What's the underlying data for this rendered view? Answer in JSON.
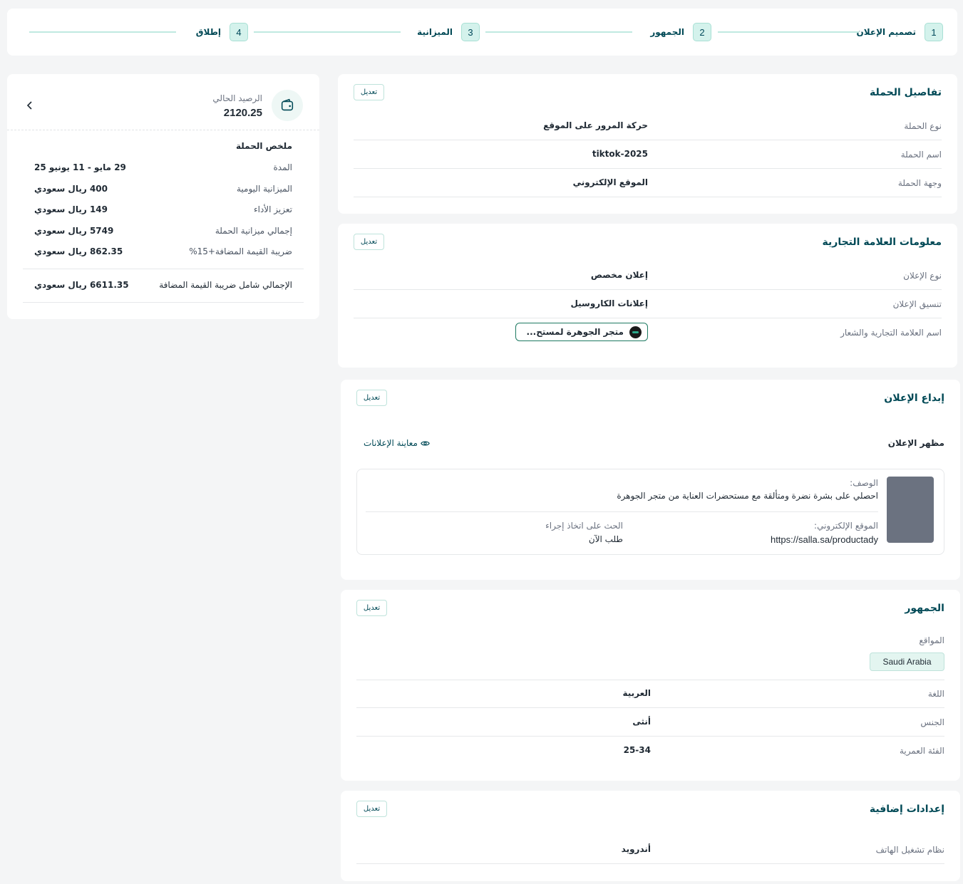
{
  "stepper": {
    "steps": [
      {
        "num": "1",
        "label": "تصميم الإعلان"
      },
      {
        "num": "2",
        "label": "الجمهور"
      },
      {
        "num": "3",
        "label": "الميزانية"
      },
      {
        "num": "4",
        "label": "إطلاق"
      }
    ]
  },
  "common": {
    "edit_label": "تعديل"
  },
  "campaign_details": {
    "title": "تفاصيل الحملة",
    "rows": [
      {
        "label": "نوع الحملة",
        "value": "حركة المرور على الموقع"
      },
      {
        "label": "اسم الحملة",
        "value": "tiktok-2025"
      },
      {
        "label": "وجهة الحملة",
        "value": "الموقع الإلكتروني"
      }
    ]
  },
  "brand_info": {
    "title": "معلومات العلامة التجارية",
    "rows": [
      {
        "label": "نوع الإعلان",
        "value": "إعلان مخصص"
      },
      {
        "label": "تنسيق الإعلان",
        "value": "إعلانات الكاروسيل"
      }
    ],
    "brand_label": "اسم العلامة التجارية والشعار",
    "brand_name": "متجر الجوهرة لمستح..."
  },
  "creative": {
    "title": "إبداع الإعلان",
    "appearance_label": "مظهر الإعلان",
    "preview_link": "معاينة الإعلانات",
    "description_label": "الوصف:",
    "description": "احصلي على بشرة نضرة ومتألقة مع مستحضرات العناية من متجر الجوهرة",
    "website_label": "الموقع الإلكتروني:",
    "website": "https://salla.sa/productady",
    "cta_label": "الحث على اتخاذ إجراء",
    "cta": "طلب الآن"
  },
  "audience": {
    "title": "الجمهور",
    "locations_label": "المواقع",
    "location_chip": "Saudi Arabia",
    "rows": [
      {
        "label": "اللغة",
        "value": "العربية"
      },
      {
        "label": "الجنس",
        "value": "أنثى"
      },
      {
        "label": "الفئة العمرية",
        "value": "25-34"
      }
    ]
  },
  "extra": {
    "title": "إعدادات إضافية",
    "rows": [
      {
        "label": "نظام تشغيل الهاتف",
        "value": "أندرويد"
      }
    ]
  },
  "summary": {
    "balance_label": "الرصيد الحالي",
    "balance": "2120.25",
    "title": "ملخص الحملة",
    "rows": [
      {
        "label": "المدة",
        "value": "29 مايو - 11 يونيو 25"
      },
      {
        "label": "الميزانية اليومية",
        "value": "400 ريال سعودي"
      },
      {
        "label": "تعزيز الأداء",
        "value": "149 ريال سعودي"
      },
      {
        "label": "إجمالي ميزانية الحملة",
        "value": "5749 ريال سعودي"
      },
      {
        "label": "ضريبة القيمة المضافة+15%",
        "value": "862.35 ريال سعودي"
      }
    ],
    "total_label": "الإجمالي شامل ضريبة القيمة المضافة",
    "total_value": "6611.35 ريال سعودي"
  },
  "icons": {
    "wallet": "wallet-icon",
    "chevron": "chevron-left-icon",
    "eye": "eye-icon"
  },
  "colors": {
    "accent": "#004956",
    "step_bg": "#d4f2ec",
    "chip_bg": "#e3f5f0"
  }
}
